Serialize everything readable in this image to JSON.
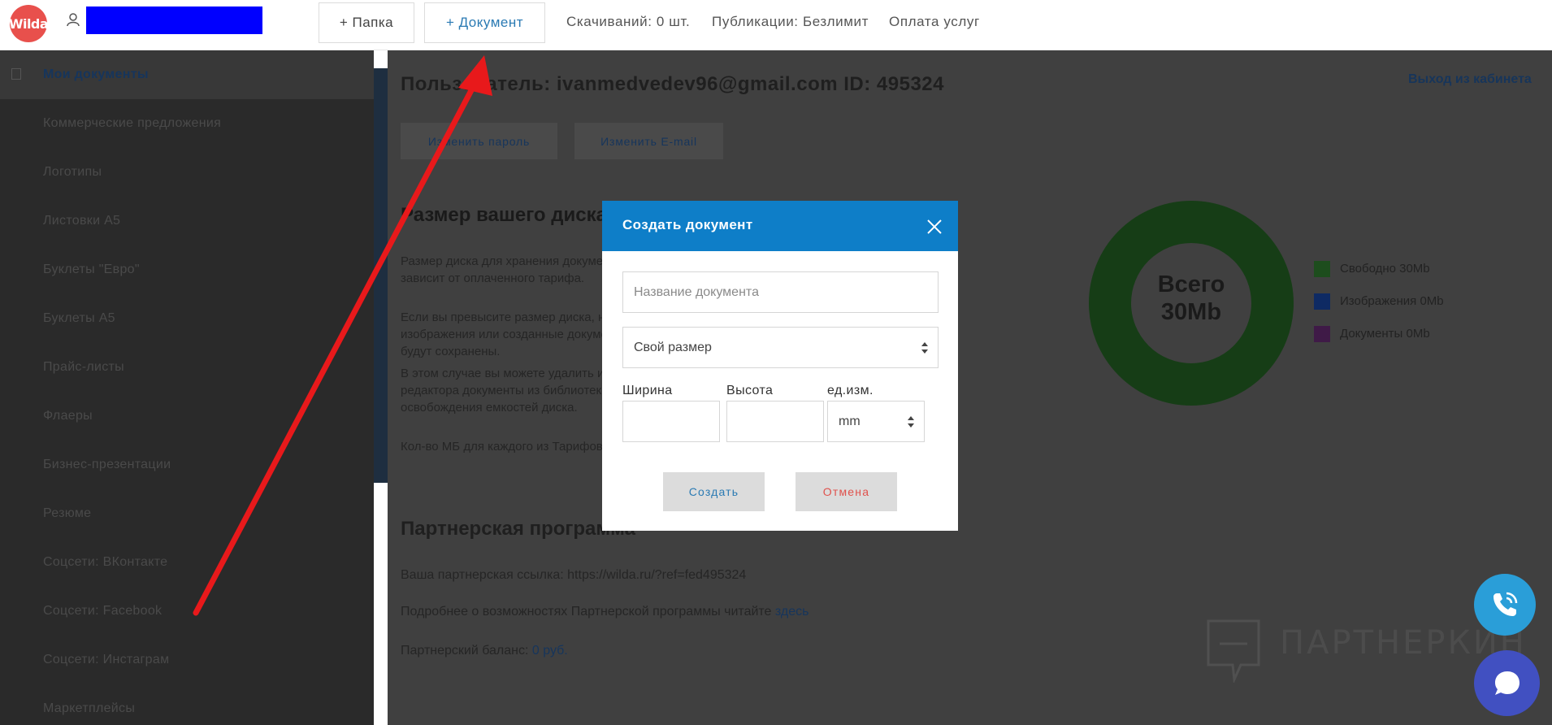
{
  "app": {
    "logo_text": "Wilda"
  },
  "header": {
    "add_folder_label": "+ Папка",
    "add_document_label": "+ Документ",
    "downloads_label": "Скачиваний: 0 шт.",
    "publications_label": "Публикации: Безлимит",
    "payment_label": "Оплата услуг"
  },
  "sidebar": {
    "items": [
      {
        "label": "Мои документы",
        "active": true
      },
      {
        "label": "Коммерческие предложения"
      },
      {
        "label": "Логотипы"
      },
      {
        "label": "Листовки А5"
      },
      {
        "label": "Буклеты \"Евро\""
      },
      {
        "label": "Буклеты А5"
      },
      {
        "label": "Прайс-листы"
      },
      {
        "label": "Флаеры"
      },
      {
        "label": "Бизнес-презентации"
      },
      {
        "label": "Резюме"
      },
      {
        "label": "Соцсети: ВКонтакте"
      },
      {
        "label": "Соцсети: Facebook"
      },
      {
        "label": "Соцсети: Инстаграм"
      },
      {
        "label": "Маркетплейсы"
      }
    ]
  },
  "profile": {
    "title": "Пользователь: ivanmedvedev96@gmail.com ID: 495324",
    "logout_label": "Выход из кабинета",
    "btn_password": "Изменить пароль",
    "btn_email": "Изменить E-mail"
  },
  "disk": {
    "title": "Размер вашего диска",
    "p1": "Размер диска для хранения документов зависит от оплаченного тарифа.",
    "p2": "Если вы превысите размер диска, новые изображения или созданные документы не будут сохранены.",
    "p3": "В этом случае вы можете удалить из редактора документы из библиотеки для освобождения емкостей диска.",
    "p4": "Кол-во МБ для каждого из Тарифов"
  },
  "donut": {
    "label_line1": "Всего",
    "label_line2": "30Mb",
    "legend": [
      {
        "label": "Свободно 30Mb",
        "color": "#1d4d1d"
      },
      {
        "label": "Изображения 0Mb",
        "color": "#0e2a63"
      },
      {
        "label": "Документы 0Mb",
        "color": "#3f1a47"
      }
    ]
  },
  "partner": {
    "title": "Партнерская программа",
    "link_text": "Ваша партнерская ссылка: https://wilda.ru/?ref=fed495324",
    "info_prefix": "Подробнее о возможностях Партнерской программы читайте",
    "info_link": "здесь",
    "balance_prefix": "Партнерский баланс:",
    "balance_value": "0 руб."
  },
  "modal": {
    "title": "Создать документ",
    "name_placeholder": "Название документа",
    "size_value": "Свой размер",
    "width_label": "Ширина",
    "height_label": "Высота",
    "unit_label": "ед.изм.",
    "unit_value": "mm",
    "create_label": "Создать",
    "cancel_label": "Отмена"
  },
  "watermark": {
    "text": "ПАРТНЕРКИН"
  },
  "colors": {
    "accent": "#0e7ec8",
    "logo_red": "#e8504c",
    "arrow_red": "#e8191b",
    "call_button": "#2a9ed8",
    "chat_button": "#4150c1"
  }
}
